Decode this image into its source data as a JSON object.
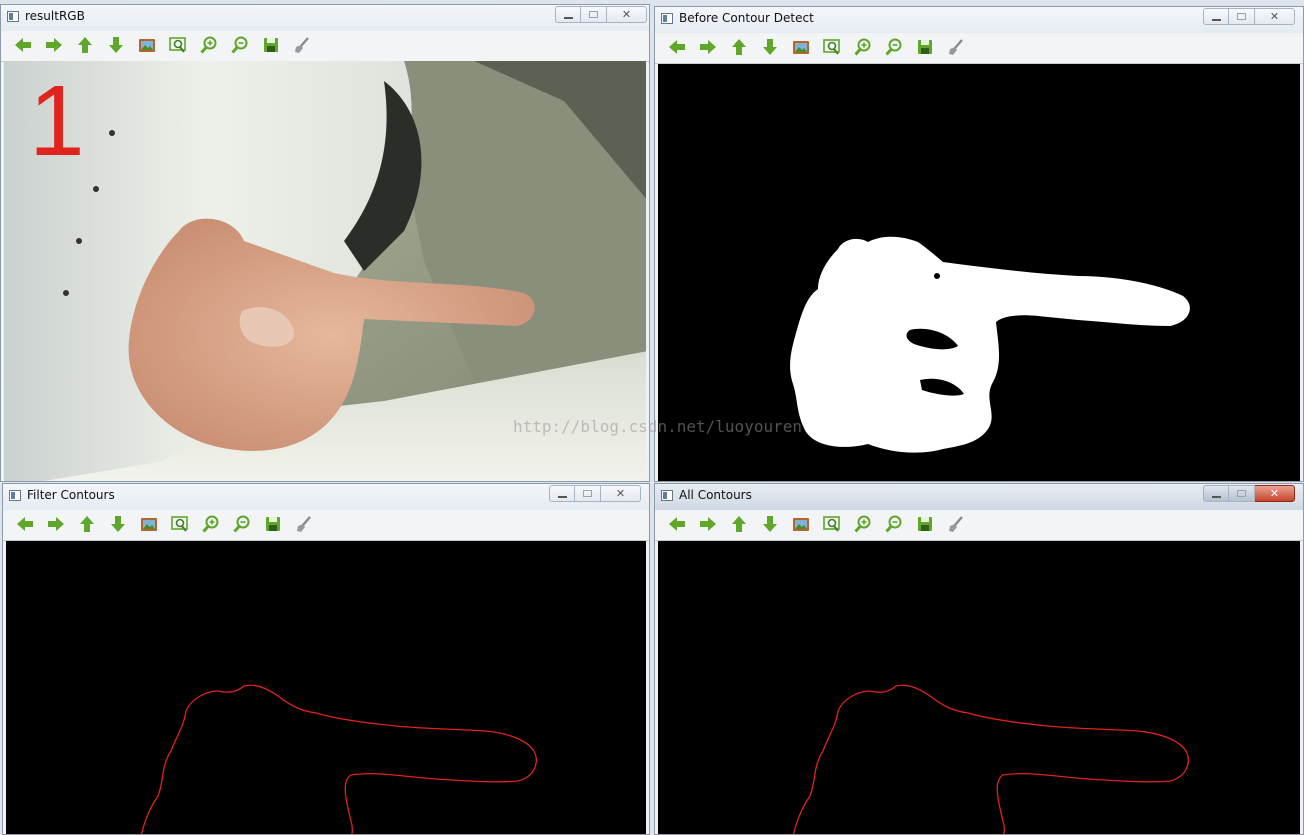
{
  "windows": {
    "rgb": {
      "title": "resultRGB",
      "overlay_number": "1"
    },
    "before": {
      "title": "Before Contour Detect"
    },
    "filter": {
      "title": "Filter Contours"
    },
    "all": {
      "title": "All Contours"
    }
  },
  "toolbar_icons": [
    "arrow-left-icon",
    "arrow-right-icon",
    "arrow-up-icon",
    "arrow-down-icon",
    "image-icon",
    "zoom-fit-icon",
    "zoom-in-icon",
    "zoom-out-icon",
    "save-icon",
    "properties-icon"
  ],
  "colors": {
    "contour": "#e0231c",
    "toolbar_icon": "#5fa62a",
    "canvas_bg": "#000000",
    "mask": "#ffffff"
  },
  "watermark": "http://blog.csdn.net/luoyouren"
}
